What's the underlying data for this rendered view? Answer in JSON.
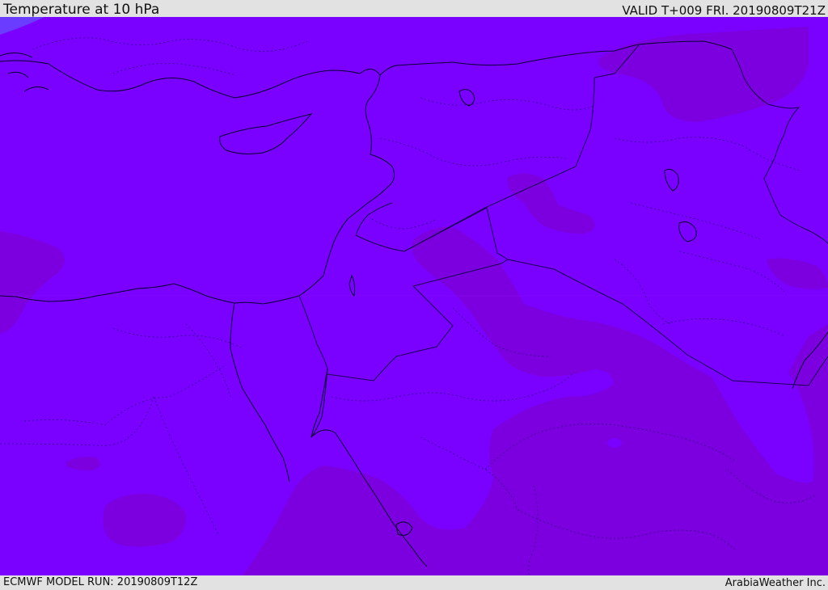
{
  "header": {
    "title": "Temperature at 10 hPa",
    "valid": "VALID T+009 FRI. 20190809T21Z"
  },
  "footer": {
    "model_run": "ECMWF MODEL RUN: 20190809T12Z",
    "credit": "ArabiaWeather Inc."
  },
  "map": {
    "colors": {
      "background_fill": "#7a00ff",
      "warm_fill": "#7c00df",
      "cool_fill": "#6a3cff",
      "coastline": "#0a0030",
      "border": "#1a0050"
    }
  }
}
